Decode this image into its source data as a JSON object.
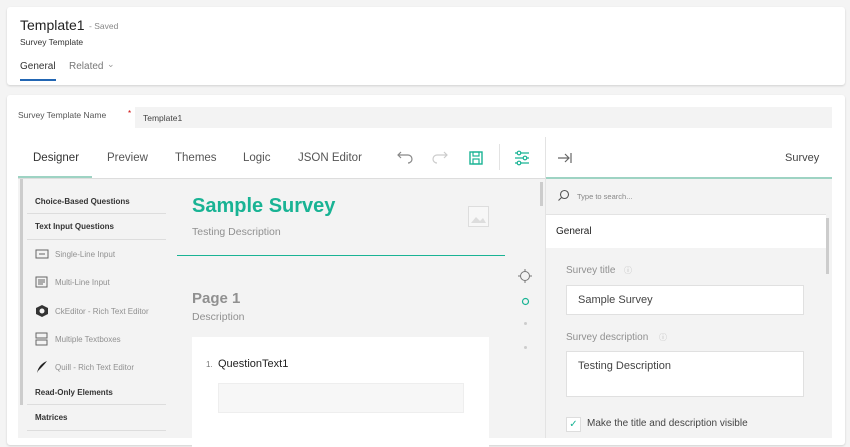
{
  "header": {
    "title": "Template1",
    "status": "- Saved",
    "subtitle": "Survey Template",
    "tabs": [
      {
        "label": "General"
      },
      {
        "label": "Related"
      }
    ]
  },
  "form": {
    "name_label": "Survey Template Name",
    "required_mark": "*",
    "name_value": "Template1"
  },
  "creator": {
    "tabs": [
      {
        "label": "Designer"
      },
      {
        "label": "Preview"
      },
      {
        "label": "Themes"
      },
      {
        "label": "Logic"
      },
      {
        "label": "JSON Editor"
      }
    ],
    "toolbox": {
      "categories": [
        "Choice-Based Questions",
        "Text Input Questions",
        "Read-Only Elements",
        "Matrices"
      ],
      "items": [
        {
          "label": "Single-Line Input",
          "icon": "single-line-icon"
        },
        {
          "label": "Multi-Line Input",
          "icon": "multi-line-icon"
        },
        {
          "label": "CkEditor - Rich Text Editor",
          "icon": "ckeditor-icon"
        },
        {
          "label": "Multiple Textboxes",
          "icon": "multiple-textboxes-icon"
        },
        {
          "label": "Quill - Rich Text Editor",
          "icon": "quill-icon"
        }
      ]
    },
    "canvas": {
      "survey_title": "Sample Survey",
      "survey_description": "Testing Description",
      "page_title": "Page 1",
      "page_description": "Description",
      "question_number": "1.",
      "question_title": "QuestionText1"
    },
    "panel": {
      "title": "Survey",
      "search_placeholder": "Type to search...",
      "section": "General",
      "survey_title_label": "Survey title",
      "survey_title_value": "Sample Survey",
      "survey_description_label": "Survey description",
      "survey_description_value": "Testing Description",
      "visible_checkbox_label": "Make the title and description visible",
      "visible_checked": true
    }
  },
  "colors": {
    "accent": "#19b394",
    "tab_underline": "#2266b3"
  }
}
